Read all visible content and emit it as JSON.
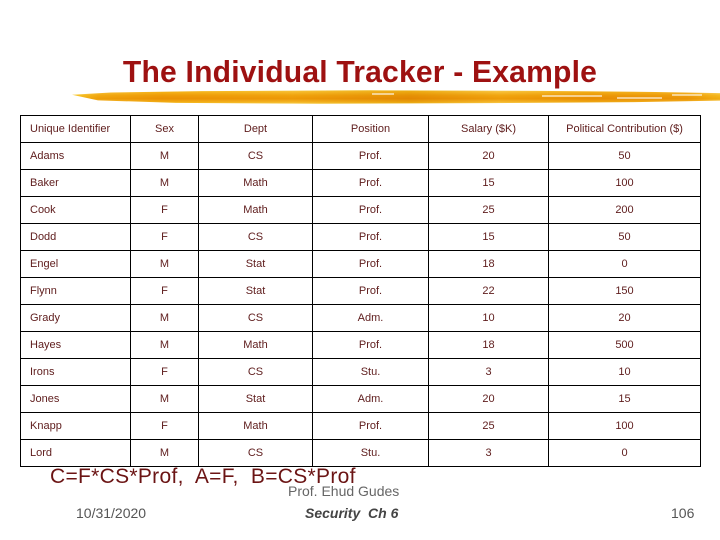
{
  "slide": {
    "title": "The Individual Tracker - Example",
    "title_color": "#9E1111",
    "accent_brush_color": "#F3BF25"
  },
  "table": {
    "text_color": "#5E1C1C",
    "border_color": "#000000",
    "columns": [
      "Unique Identifier",
      "Sex",
      "Dept",
      "Position",
      "Salary ($K)",
      "Political Contribution ($)"
    ],
    "rows": [
      [
        "Adams",
        "M",
        "CS",
        "Prof.",
        "20",
        "50"
      ],
      [
        "Baker",
        "M",
        "Math",
        "Prof.",
        "15",
        "100"
      ],
      [
        "Cook",
        "F",
        "Math",
        "Prof.",
        "25",
        "200"
      ],
      [
        "Dodd",
        "F",
        "CS",
        "Prof.",
        "15",
        "50"
      ],
      [
        "Engel",
        "M",
        "Stat",
        "Prof.",
        "18",
        "0"
      ],
      [
        "Flynn",
        "F",
        "Stat",
        "Prof.",
        "22",
        "150"
      ],
      [
        "Grady",
        "M",
        "CS",
        "Adm.",
        "10",
        "20"
      ],
      [
        "Hayes",
        "M",
        "Math",
        "Prof.",
        "18",
        "500"
      ],
      [
        "Irons",
        "F",
        "CS",
        "Stu.",
        "3",
        "10"
      ],
      [
        "Jones",
        "M",
        "Stat",
        "Adm.",
        "20",
        "15"
      ],
      [
        "Knapp",
        "F",
        "Math",
        "Prof.",
        "25",
        "100"
      ],
      [
        "Lord",
        "M",
        "CS",
        "Stu.",
        "3",
        "0"
      ]
    ]
  },
  "notes": {
    "formula": "C=F*CS*Prof,  A=F,  B=CS*Prof",
    "presenter": "Prof. Ehud Gudes"
  },
  "footer": {
    "date": "10/31/2020",
    "center": "Security  Ch 6",
    "page_number": "106"
  }
}
